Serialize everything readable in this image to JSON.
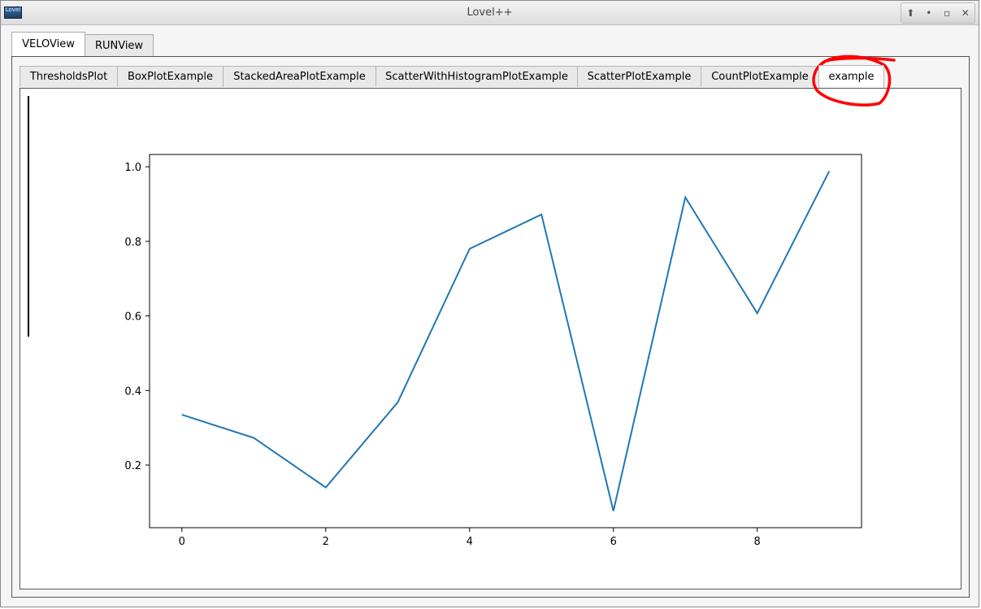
{
  "window": {
    "title": "Lovel++",
    "icon_label": "Lovel",
    "controls": [
      {
        "name": "keep-above-icon",
        "glyph": "⬆"
      },
      {
        "name": "minimize-icon",
        "glyph": "•"
      },
      {
        "name": "maximize-icon",
        "glyph": "▫"
      },
      {
        "name": "close-icon",
        "glyph": "✕"
      }
    ]
  },
  "outer_tabs": [
    {
      "label": "VELOView",
      "active": true
    },
    {
      "label": "RUNView",
      "active": false
    }
  ],
  "inner_tabs": [
    {
      "label": "ThresholdsPlot",
      "active": false
    },
    {
      "label": "BoxPlotExample",
      "active": false
    },
    {
      "label": "StackedAreaPlotExample",
      "active": false
    },
    {
      "label": "ScatterWithHistogramPlotExample",
      "active": false
    },
    {
      "label": "ScatterPlotExample",
      "active": false
    },
    {
      "label": "CountPlotExample",
      "active": false
    },
    {
      "label": "example",
      "active": true
    }
  ],
  "annotation": {
    "color": "#ff0000"
  },
  "chart_data": {
    "type": "line",
    "x": [
      0,
      1,
      2,
      3,
      4,
      5,
      6,
      7,
      8,
      9
    ],
    "series": [
      {
        "values": [
          0.335,
          0.273,
          0.14,
          0.368,
          0.78,
          0.872,
          0.077,
          0.918,
          0.607,
          0.988
        ],
        "color": "#1f77b4"
      }
    ],
    "xticks": [
      0,
      2,
      4,
      6,
      8
    ],
    "yticks": [
      0.2,
      0.4,
      0.6,
      0.8,
      1.0
    ],
    "xtick_labels": [
      "0",
      "2",
      "4",
      "6",
      "8"
    ],
    "ytick_labels": [
      "0.2",
      "0.4",
      "0.6",
      "0.8",
      "1.0"
    ],
    "xlim": [
      -0.45,
      9.45
    ],
    "ylim": [
      0.032,
      1.033
    ],
    "title": "",
    "xlabel": "",
    "ylabel": "",
    "grid": false
  }
}
